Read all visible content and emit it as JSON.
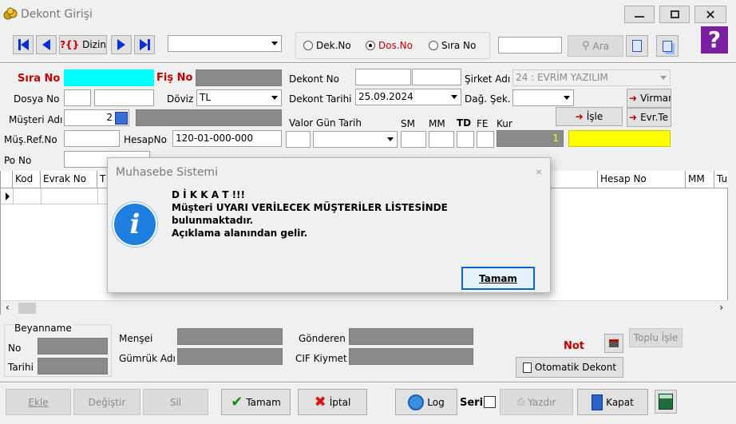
{
  "window": {
    "title": "Dekont Girişi"
  },
  "toolbar": {
    "dizin_label": "Dizin",
    "radio_dek": "Dek.No",
    "radio_dos": "Dos.No",
    "radio_sira": "Sıra No",
    "ara_label": "Ara",
    "selected_radio": "Dos.No"
  },
  "form": {
    "sira_no_label": "Sıra No",
    "fis_no_label": "Fiş No",
    "dekont_no_label": "Dekont No",
    "sirket_adi_label": "Şirket Adı",
    "sirket_adi_value": "24 : EVRİM YAZILIM",
    "dosya_no_label": "Dosya No",
    "doviz_label": "Döviz",
    "doviz_value": "TL",
    "dekont_tarihi_label": "Dekont Tarihi",
    "dekont_tarihi_value": "25.09.2024",
    "dag_sek_label": "Dağ. Şek.",
    "virman_label": "Virman",
    "musteri_adi_label": "Müşteri Adı",
    "musteri_adi_value": "2",
    "valor_gun_tarih_label": "Valor Gün Tarih",
    "sm_label": "SM",
    "mm_label": "MM",
    "td_label": "TD",
    "fe_label": "FE",
    "kur_label": "Kur",
    "isle_label": "İşle",
    "evr_te_label": "Evr.Te",
    "mus_ref_no_label": "Müş.Ref.No",
    "hesap_no_label": "HesapNo",
    "hesap_no_value": "120-01-000-000",
    "kur_value": "1",
    "po_no_label": "Po No"
  },
  "grid": {
    "columns": [
      "Kod",
      "Evrak No",
      "T",
      "Hesap No",
      "MM",
      "Tu"
    ]
  },
  "dialog": {
    "title": "Muhasebe Sistemi",
    "line1": "D İ K K A T !!!",
    "line2": "Müşteri UYARI VERİLECEK MÜŞTERİLER LİSTESİNDE",
    "line3": "bulunmaktadır.",
    "line4": "Açıklama alanından gelir.",
    "ok_label": "Tamam"
  },
  "bottom": {
    "beyanname_label": "Beyanname",
    "no_label": "No",
    "tarihi_label": "Tarihi",
    "mensei_label": "Menşei",
    "gumruk_adi_label": "Gümrük Adı",
    "gonderen_label": "Gönderen",
    "cif_kiymet_label": "CIF Kiymet",
    "not_label": "Not",
    "toplu_isle_label": "Toplu İşle",
    "otomatik_dekont_label": "Otomatik Dekont"
  },
  "actions": {
    "ekle": "Ekle",
    "degistir": "Değiştir",
    "sil": "Sil",
    "tamam": "Tamam",
    "iptal": "İptal",
    "log": "Log",
    "seri": "Seri",
    "yazdir": "Yazdır",
    "kapat": "Kapat"
  },
  "colors": {
    "accent_cyan": "#00ffff",
    "highlight_yellow": "#ffff00",
    "label_red": "#c00000",
    "nav_blue": "#0a2ed6"
  }
}
